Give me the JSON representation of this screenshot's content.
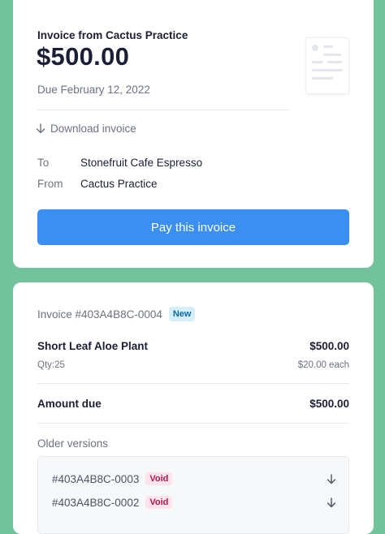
{
  "invoice": {
    "title": "Invoice from Cactus Practice",
    "amount": "$500.00",
    "due_date": "Due February 12, 2022",
    "download_label": "Download invoice",
    "to_label": "To",
    "to_value": "Stonefruit Cafe Espresso",
    "from_label": "From",
    "from_value": "Cactus Practice",
    "pay_button": "Pay this invoice"
  },
  "details": {
    "invoice_number": "Invoice #403A4B8C-0004",
    "status_badge": "New",
    "line_items": [
      {
        "name": "Short Leaf Aloe Plant",
        "price": "$500.00",
        "qty": "Qty:25",
        "unit_price": "$20.00 each"
      }
    ],
    "amount_due_label": "Amount due",
    "amount_due_value": "$500.00",
    "older_versions_label": "Older versions",
    "older_versions": [
      {
        "id": "#403A4B8C-0003",
        "status": "Void"
      },
      {
        "id": "#403A4B8C-0002",
        "status": "Void"
      }
    ]
  },
  "colors": {
    "background": "#72c39c",
    "primary_button": "#3b8ff0",
    "new_badge": "#d5eef9",
    "void_badge": "#fde4ec"
  },
  "icons": [
    "arrow-down-icon",
    "document-illustration"
  ]
}
